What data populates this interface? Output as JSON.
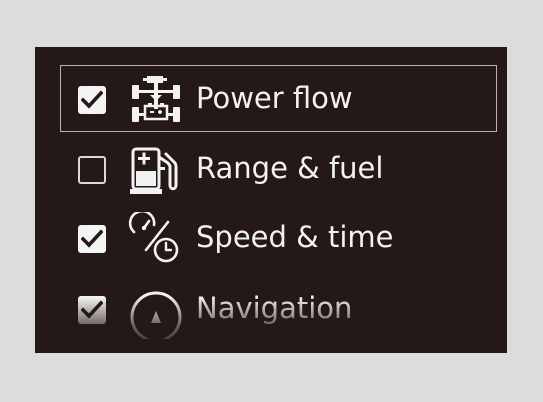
{
  "menu": {
    "items": [
      {
        "label": "Power flow",
        "checked": true,
        "icon": "power-flow-icon",
        "selected": true
      },
      {
        "label": "Range & fuel",
        "checked": false,
        "icon": "fuel-pump-icon",
        "selected": false
      },
      {
        "label": "Speed & time",
        "checked": true,
        "icon": "speedometer-clock-icon",
        "selected": false
      },
      {
        "label": "Navigation",
        "checked": true,
        "icon": "navigation-compass-icon",
        "selected": false
      }
    ]
  },
  "colors": {
    "panel_background": "#241917",
    "page_background": "#dcdcdc",
    "text": "#f2f2f2",
    "focus_frame": "#b9b2ae"
  }
}
